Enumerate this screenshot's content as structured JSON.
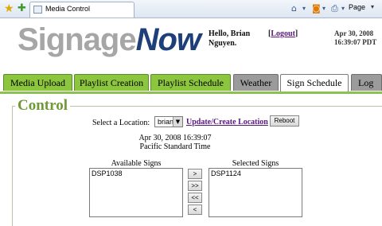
{
  "browser": {
    "tab_title": "Media Control",
    "page_menu": "Page"
  },
  "header": {
    "logo_part1": "Signage",
    "logo_part2": "Now",
    "greeting": "Hello, Brian Nguyen.",
    "logout_open": "[",
    "logout_label": "Logout",
    "logout_close": "]",
    "date_line1": "Apr 30, 2008",
    "date_line2": "16:39:07 PDT"
  },
  "nav": {
    "tabs": [
      {
        "label": "Media Upload"
      },
      {
        "label": "Playlist Creation"
      },
      {
        "label": "Playlist Schedule"
      },
      {
        "label": "Weather"
      },
      {
        "label": "Sign Schedule"
      },
      {
        "label": "Log"
      }
    ],
    "active_tab": "Sign Schedule"
  },
  "control": {
    "title": "Control",
    "location_label": "Select a Location:",
    "location_value": "brian",
    "update_link": "Update/Create Location",
    "reboot_label": "Reboot",
    "time_line1": "Apr 30, 2008 16:39:07",
    "time_line2": "Pacific Standard Time",
    "available_label": "Available Signs",
    "selected_label": "Selected Signs",
    "available_signs": [
      "DSP1038"
    ],
    "selected_signs": [
      "DSP1124"
    ],
    "move_buttons": [
      ">",
      ">>",
      "<<",
      "<"
    ]
  },
  "colors": {
    "tab_green": "#8cc63f",
    "tab_gray": "#9b9b9b",
    "logo_gray": "#a6a6a6",
    "logo_blue": "#1f3f78",
    "control_title": "#6e9a36",
    "link_purple": "#5a1780"
  },
  "icons": [
    "favorites-star-icon",
    "add-favorites-icon",
    "home-icon",
    "feeds-icon",
    "print-icon",
    "chevron-down-icon"
  ]
}
